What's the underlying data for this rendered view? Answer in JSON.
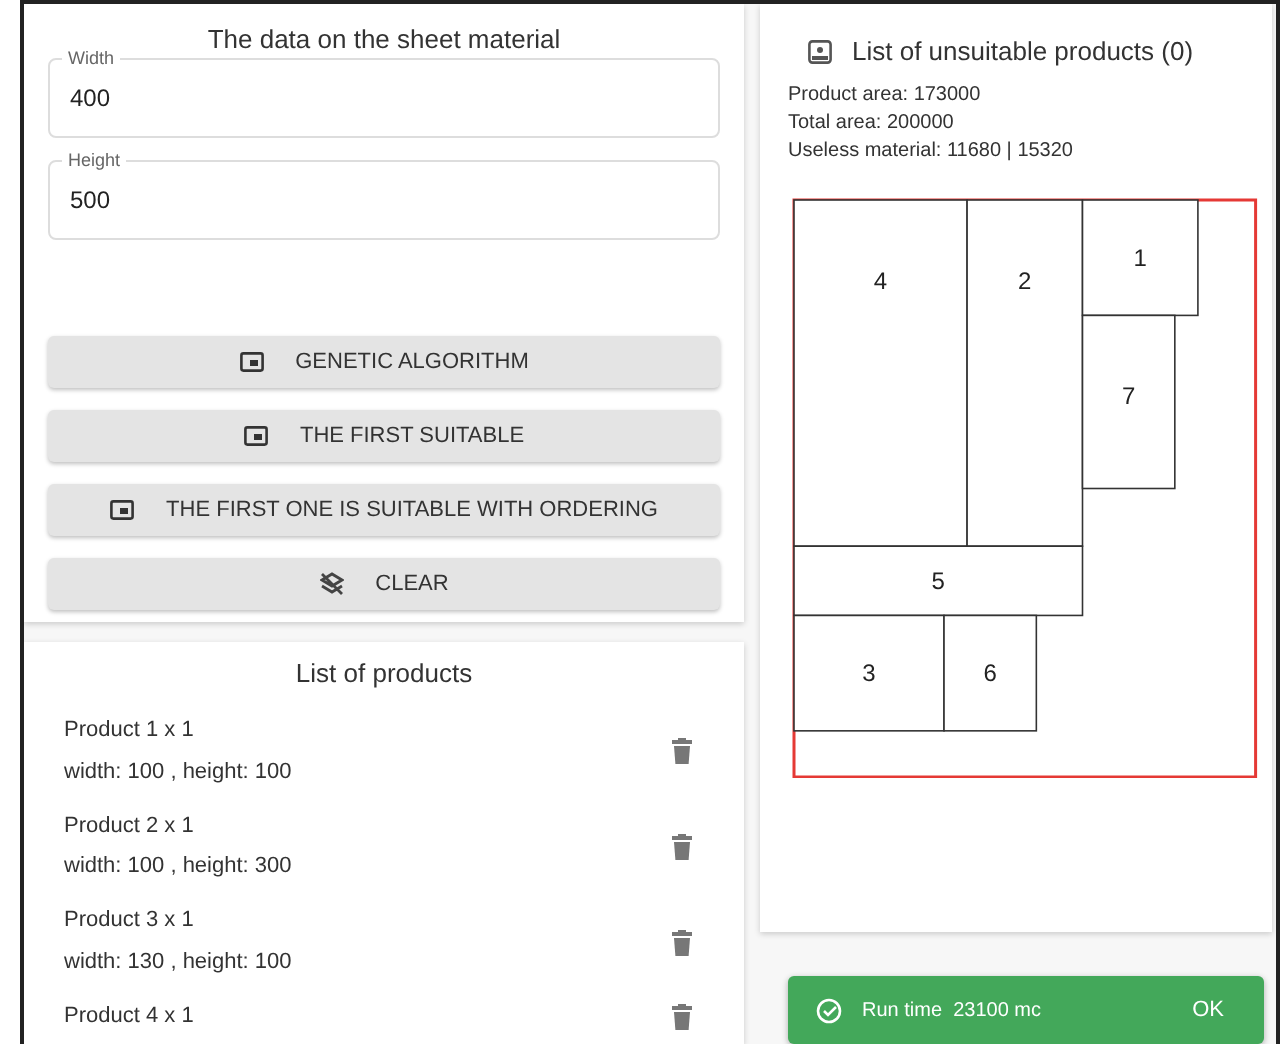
{
  "sheet_form": {
    "title": "The data on the sheet material",
    "fields": [
      {
        "label": "Width",
        "value": "400"
      },
      {
        "label": "Height",
        "value": "500"
      }
    ],
    "buttons": [
      {
        "label": "GENETIC ALGORITHM",
        "kind": "run"
      },
      {
        "label": "THE FIRST SUITABLE",
        "kind": "run"
      },
      {
        "label": "THE FIRST ONE IS SUITABLE WITH ORDERING",
        "kind": "run"
      },
      {
        "label": "CLEAR",
        "kind": "clear"
      }
    ]
  },
  "products": {
    "title": "List of products",
    "items": [
      {
        "name": "Product  1 x 1",
        "size": "width: 100 , height: 100"
      },
      {
        "name": "Product  2 x 1",
        "size": "width: 100 , height: 300"
      },
      {
        "name": "Product  3 x 1",
        "size": "width: 130 , height: 100"
      },
      {
        "name": "Product  4 x 1"
      }
    ]
  },
  "result": {
    "title": "List of unsuitable products (0)",
    "stats": [
      "Product area: 173000",
      "Total area: 200000",
      "Useless material: 11680 | 15320"
    ],
    "sheet": {
      "placements": [
        {
          "label": "4"
        },
        {
          "label": "2"
        },
        {
          "label": "1"
        },
        {
          "label": "7"
        },
        {
          "label": "5"
        },
        {
          "label": "3"
        },
        {
          "label": "6"
        }
      ]
    }
  },
  "snackbar": {
    "message": "Run time  23100 mc",
    "action": "OK"
  }
}
